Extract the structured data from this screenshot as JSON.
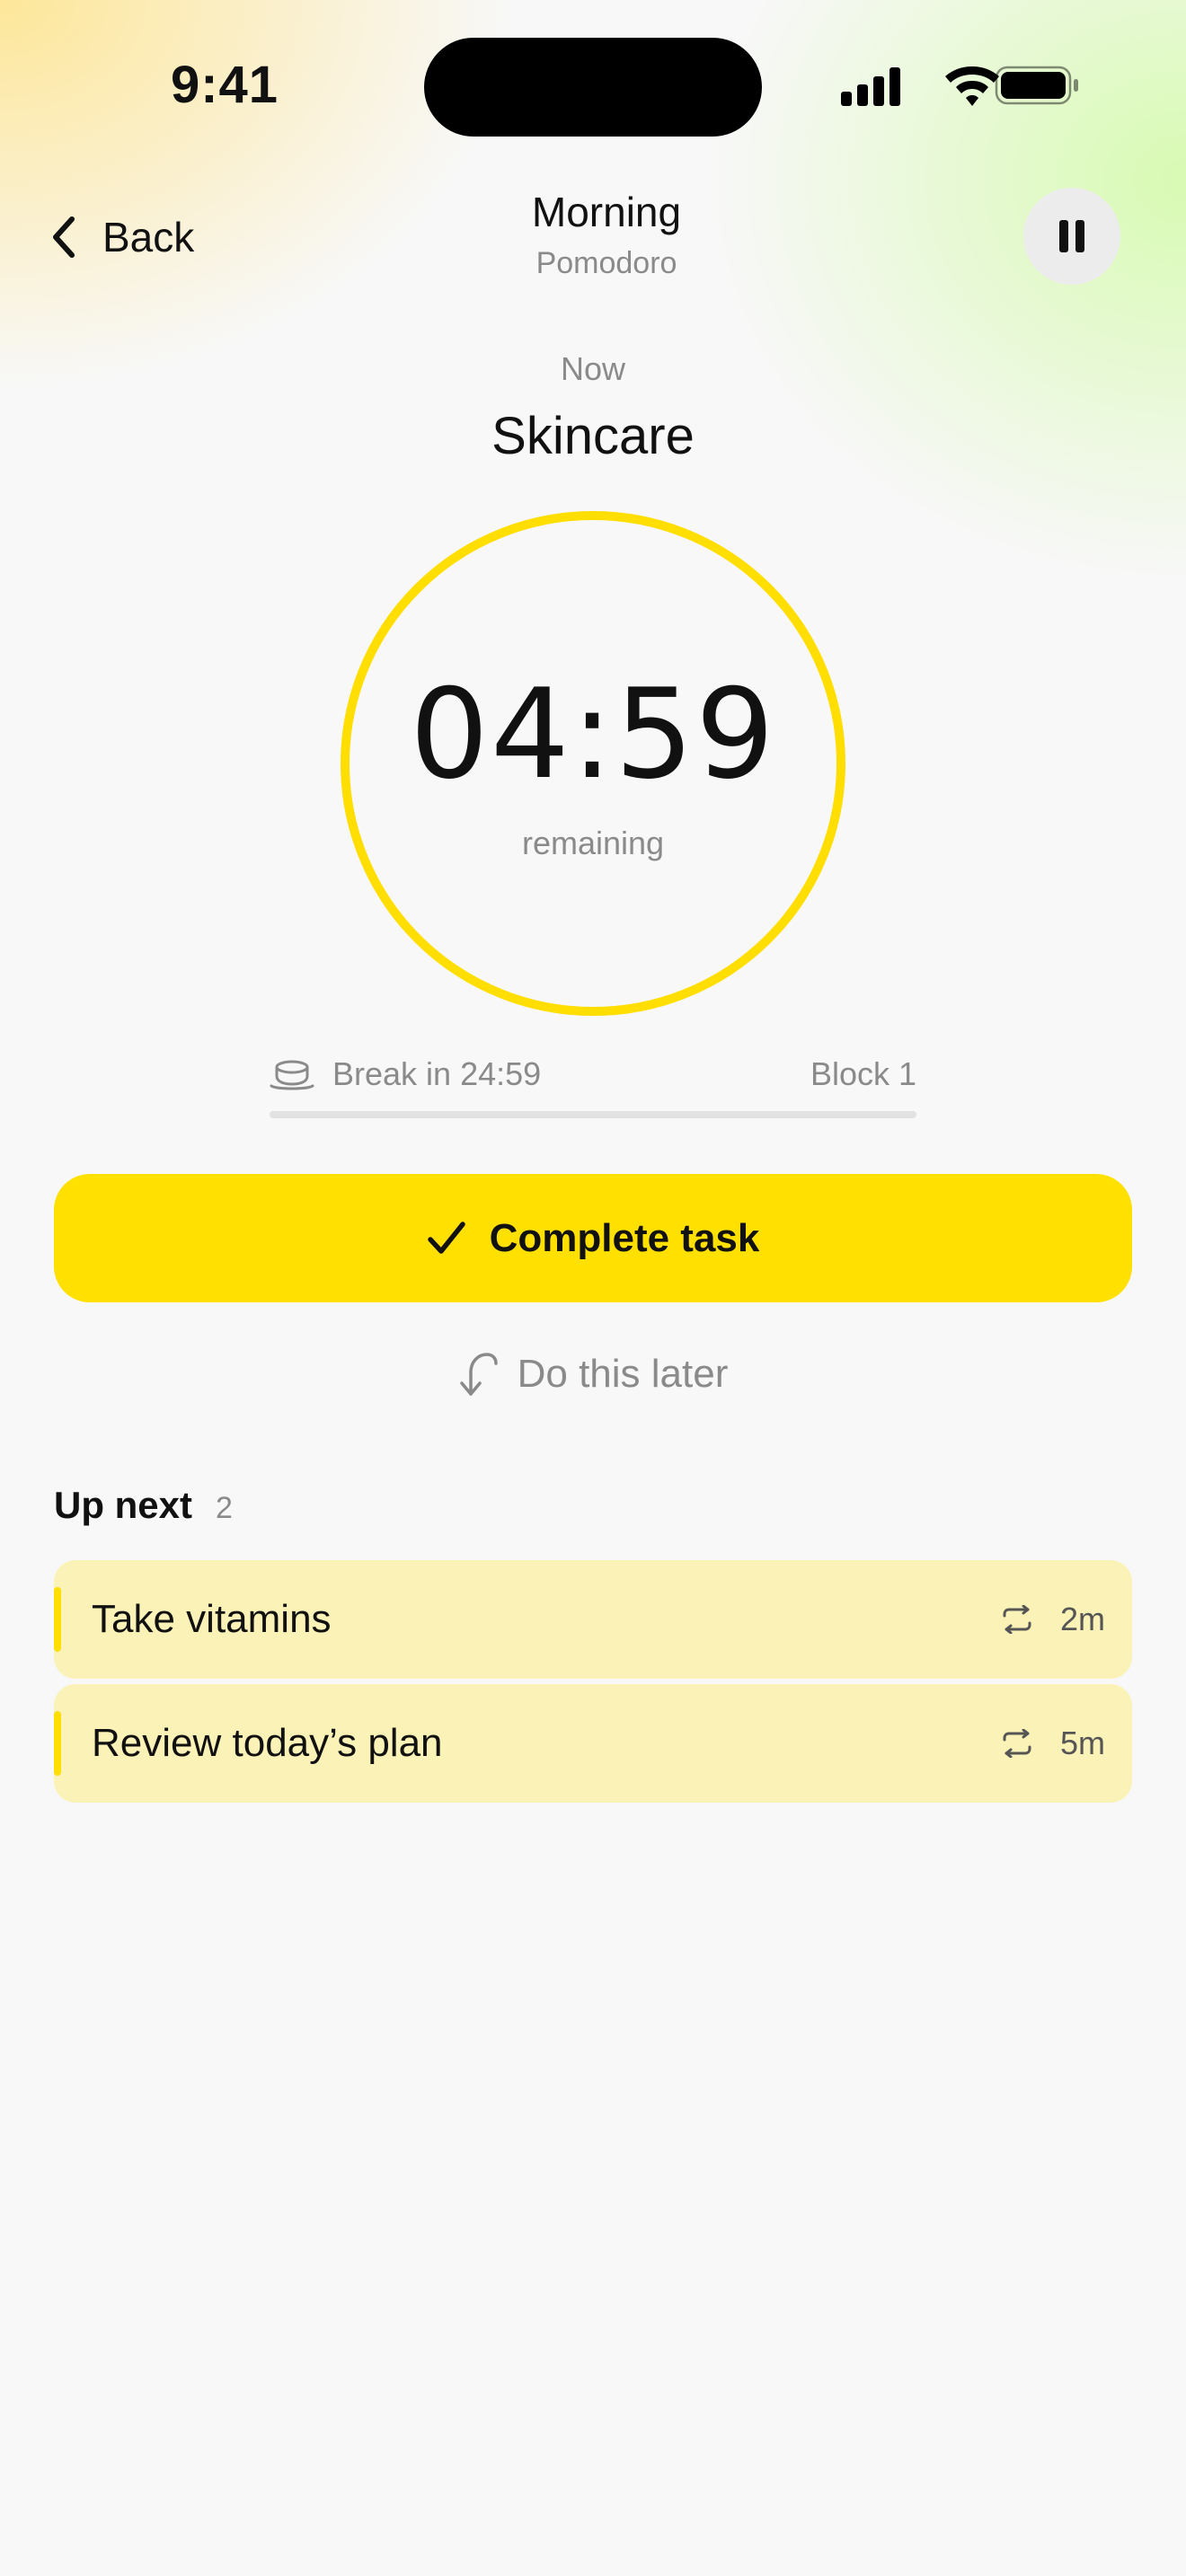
{
  "status_bar": {
    "time": "9:41"
  },
  "header": {
    "back_label": "Back",
    "title": "Morning",
    "subtitle": "Pomodoro"
  },
  "current": {
    "label": "Now",
    "task": "Skincare",
    "time_remaining": "04:59",
    "remaining_label": "remaining",
    "progress_fraction": 0.0
  },
  "break_info": {
    "text": "Break in 24:59",
    "block": "Block 1",
    "progress_fraction": 0.0
  },
  "actions": {
    "complete_label": "Complete task",
    "later_label": "Do this later"
  },
  "up_next": {
    "title": "Up next",
    "count": "2",
    "items": [
      {
        "name": "Take vitamins",
        "duration": "2m",
        "icon": "repeat-icon"
      },
      {
        "name": "Review today’s plan",
        "duration": "5m",
        "icon": "repeat-icon"
      }
    ]
  },
  "colors": {
    "accent": "#ffde00",
    "card_bg": "#fbf2b8",
    "muted_text": "#8a8a8a"
  }
}
